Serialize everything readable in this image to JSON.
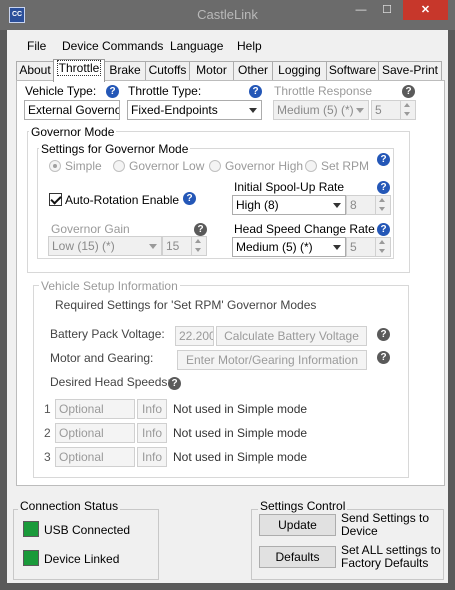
{
  "window": {
    "title": "CastleLink",
    "icon": "castle-app-icon",
    "icon_text": "CC",
    "minimize": "—",
    "maximize": "☐",
    "close": "✕"
  },
  "menu": [
    "File",
    "Device Commands",
    "Language",
    "Help"
  ],
  "tabs": [
    "About",
    "Throttle",
    "Brake",
    "Cutoffs",
    "Motor",
    "Other",
    "Logging",
    "Software",
    "Save-Print"
  ],
  "active_tab": "Throttle",
  "throttle": {
    "vehicle_type": {
      "label": "Vehicle Type:",
      "value": "External Governor"
    },
    "throttle_type": {
      "label": "Throttle Type:",
      "value": "Fixed-Endpoints"
    },
    "throttle_response": {
      "label": "Throttle Response",
      "value": "Medium (5) (*)",
      "number": "5"
    }
  },
  "governor": {
    "title": "Governor Mode",
    "settings_title": "Settings for Governor Mode",
    "modes": [
      "Simple",
      "Governor Low",
      "Governor High",
      "Set RPM"
    ],
    "selected_mode": "Simple",
    "auto_rotation": {
      "label": "Auto-Rotation Enable",
      "checked": true
    },
    "spool_up": {
      "label": "Initial Spool-Up Rate",
      "value": "High (8)",
      "number": "8"
    },
    "gain": {
      "label": "Governor Gain",
      "value": "Low (15) (*)",
      "number": "15"
    },
    "head_speed_change": {
      "label": "Head Speed Change Rate",
      "value": "Medium (5) (*)",
      "number": "5"
    }
  },
  "vehicle_setup": {
    "title": "Vehicle Setup Information",
    "required_note": "Required Settings for 'Set RPM' Governor Modes",
    "battery": {
      "label": "Battery Pack Voltage:",
      "value": "22.200",
      "button": "Calculate Battery Voltage"
    },
    "motor": {
      "label": "Motor and Gearing:",
      "button": "Enter Motor/Gearing Information"
    },
    "head_speeds": {
      "label": "Desired Head Speeds:"
    },
    "rows": [
      {
        "num": "1",
        "placeholder": "Optional",
        "info": "Info",
        "note": "Not used in Simple mode"
      },
      {
        "num": "2",
        "placeholder": "Optional",
        "info": "Info",
        "note": "Not used in Simple mode"
      },
      {
        "num": "3",
        "placeholder": "Optional",
        "info": "Info",
        "note": "Not used in Simple mode"
      }
    ]
  },
  "connection": {
    "title": "Connection Status",
    "usb": {
      "label": "USB Connected",
      "color": "#1a9a3a"
    },
    "device": {
      "label": "Device Linked",
      "color": "#1a9a3a"
    }
  },
  "settings_control": {
    "title": "Settings Control",
    "update": {
      "button": "Update",
      "desc": "Send Settings to Device"
    },
    "defaults": {
      "button": "Defaults",
      "desc": "Set ALL settings to Factory Defaults"
    }
  },
  "colors": {
    "help_icon": "#2457b7",
    "accent": "#1a9a3a"
  }
}
